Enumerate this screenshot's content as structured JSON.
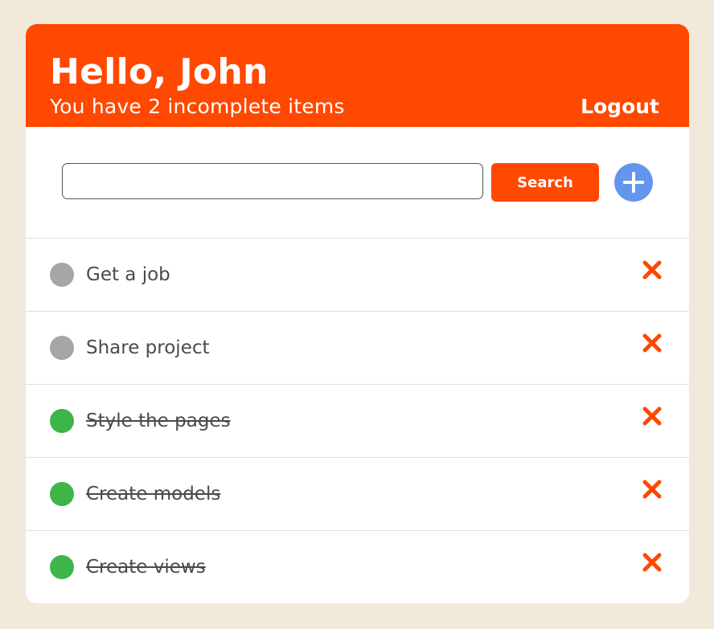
{
  "header": {
    "greeting": "Hello, John",
    "subtitle": "You have 2 incomplete items",
    "logout_label": "Logout"
  },
  "search": {
    "value": "",
    "placeholder": "",
    "button_label": "Search",
    "add_icon": "plus-icon"
  },
  "colors": {
    "accent": "#ff4800",
    "add_button": "#6495ed",
    "incomplete": "#a6a6a6",
    "complete": "#3eb549",
    "background": "#f1e9d9"
  },
  "todos": [
    {
      "title": "Get a job",
      "completed": false,
      "delete_icon": "close-icon"
    },
    {
      "title": "Share project",
      "completed": false,
      "delete_icon": "close-icon"
    },
    {
      "title": "Style the pages",
      "completed": true,
      "delete_icon": "close-icon"
    },
    {
      "title": "Create models",
      "completed": true,
      "delete_icon": "close-icon"
    },
    {
      "title": "Create views",
      "completed": true,
      "delete_icon": "close-icon"
    }
  ]
}
